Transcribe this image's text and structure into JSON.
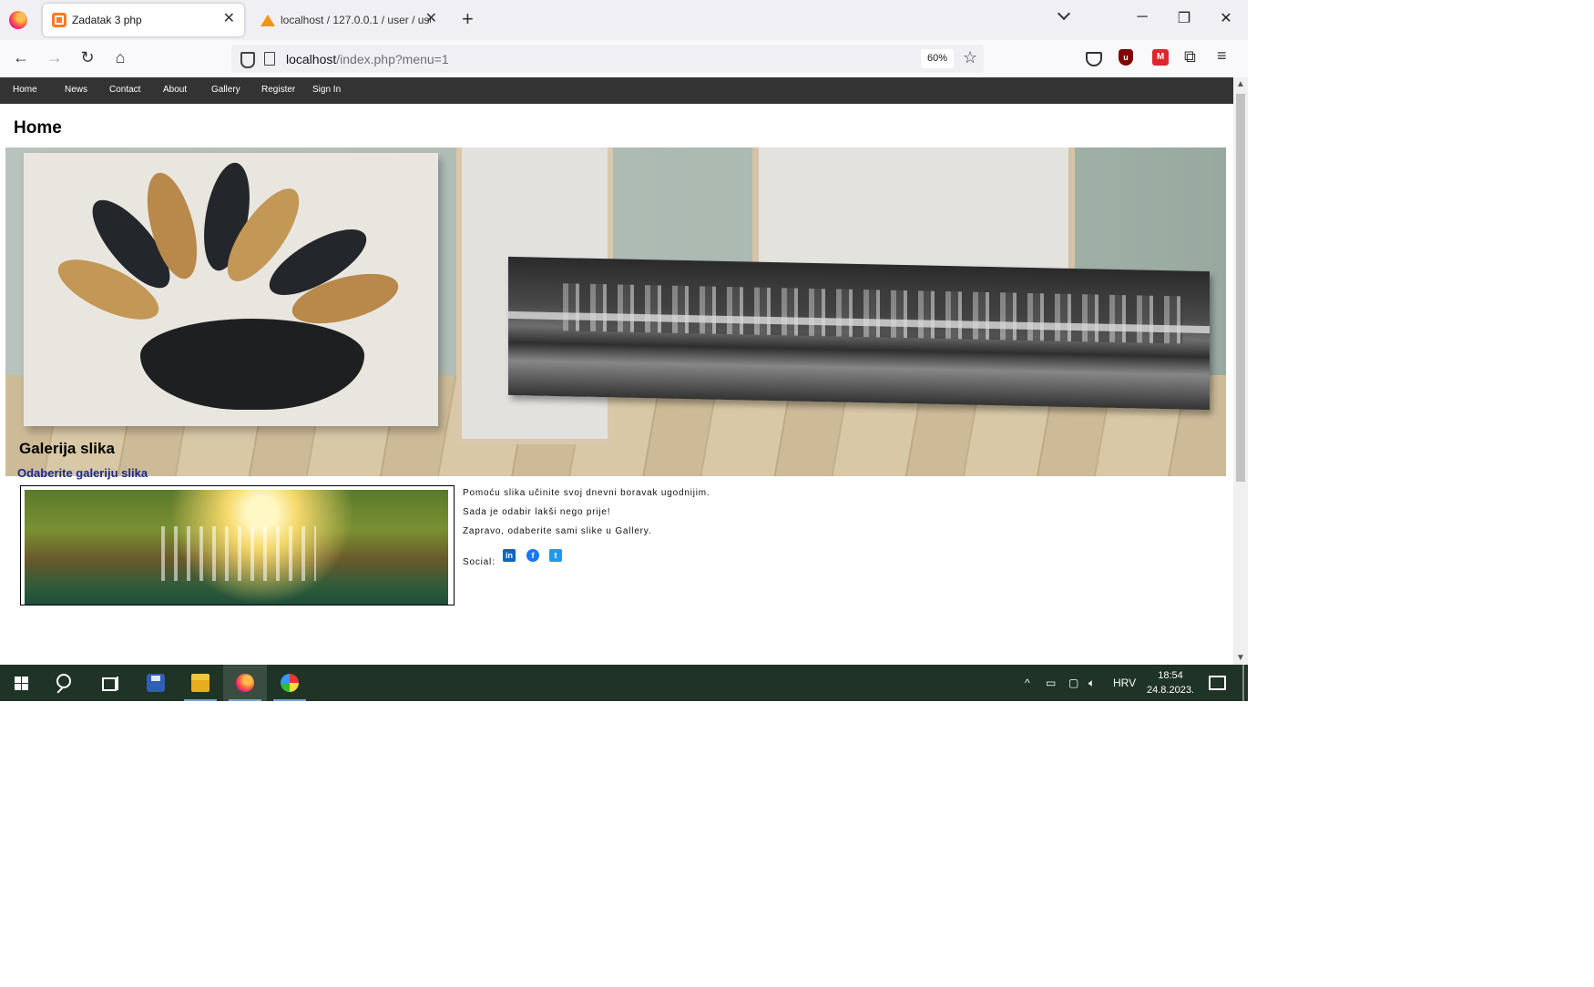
{
  "browser": {
    "tabs": [
      {
        "title": "Zadatak 3 php",
        "active": true
      },
      {
        "title": "localhost / 127.0.0.1 / user / use",
        "active": false
      }
    ],
    "url_host": "localhost",
    "url_path": "/index.php?menu=1",
    "zoom": "60%"
  },
  "site": {
    "nav": [
      "Home",
      "News",
      "Contact",
      "About",
      "Gallery",
      "Register",
      "Sign In"
    ],
    "page_title": "Home",
    "gallery_title": "Galerija slika",
    "gallery_subtitle": "Odaberite galeriju slika",
    "description": [
      "Pomoću slika učinite svoj dnevni boravak ugodnijim.",
      "Sada je odabir lakši nego prije!",
      "Zapravo, odaberite sami slike u Gallery."
    ],
    "social_label": "Social:"
  },
  "taskbar": {
    "language": "HRV",
    "time": "18:54",
    "date": "24.8.2023."
  },
  "colors": {
    "site_nav_bg": "#333333",
    "gallery_subtitle": "#1a2b8c",
    "taskbar_bg": "#1f3326"
  },
  "icons": {
    "social": [
      "linkedin-icon",
      "facebook-icon",
      "twitter-icon"
    ]
  }
}
